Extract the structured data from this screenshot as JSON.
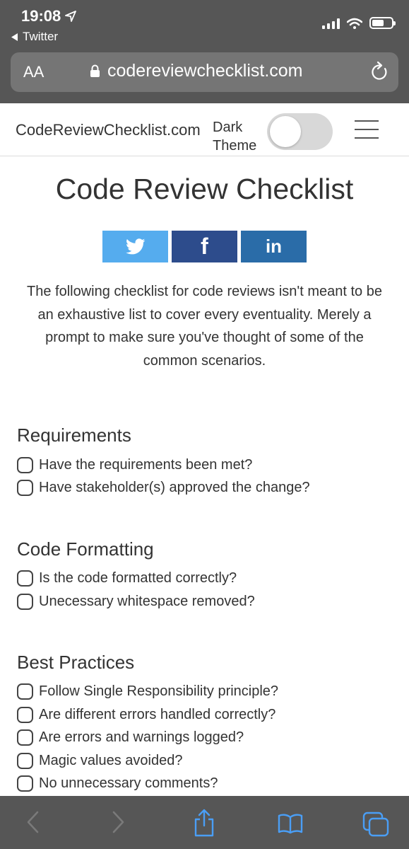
{
  "status_bar": {
    "time": "19:08",
    "back_app": "Twitter"
  },
  "browser": {
    "text_size_label": "AA",
    "url": "codereviewchecklist.com"
  },
  "site": {
    "brand": "CodeReviewChecklist.com",
    "theme_label": "Dark Theme",
    "dark_theme_on": false
  },
  "page": {
    "title": "Code Review Checklist",
    "share": [
      {
        "name": "twitter",
        "color": "#55acee"
      },
      {
        "name": "facebook",
        "label": "f",
        "color": "#2d4c8c"
      },
      {
        "name": "linkedin",
        "label": "in",
        "color": "#2a6ca8"
      }
    ],
    "intro": "The following checklist for code reviews isn't meant to be an exhaustive list to cover every eventuality. Merely a prompt to make sure you've thought of some of the common scenarios."
  },
  "sections": [
    {
      "title": "Requirements",
      "items": [
        "Have the requirements been met?",
        "Have stakeholder(s) approved the change?"
      ]
    },
    {
      "title": "Code Formatting",
      "items": [
        "Is the code formatted correctly?",
        "Unecessary whitespace removed?"
      ]
    },
    {
      "title": "Best Practices",
      "items": [
        "Follow Single Responsibility principle?",
        "Are different errors handled correctly?",
        "Are errors and warnings logged?",
        "Magic values avoided?",
        "No unnecessary comments?"
      ]
    }
  ],
  "toolbar_icons": [
    "back-icon",
    "forward-icon",
    "share-icon",
    "bookmarks-icon",
    "tabs-icon"
  ]
}
